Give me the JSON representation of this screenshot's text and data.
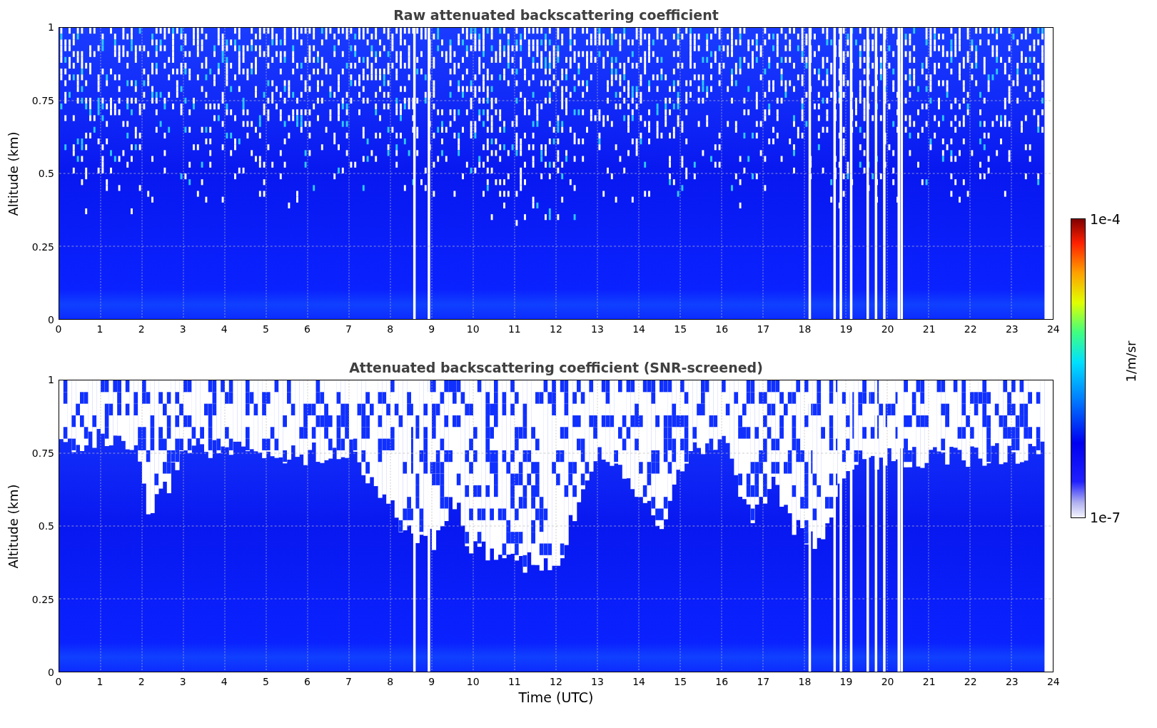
{
  "figure": {
    "panels": [
      {
        "kind": "raw",
        "title": "Raw attenuated backscattering coefficient",
        "ylabel": "Altitude (km)",
        "yticks": [
          "1",
          "0.75",
          "0.5",
          "0.25",
          "0"
        ],
        "xticks": [
          "0",
          "1",
          "2",
          "3",
          "4",
          "5",
          "6",
          "7",
          "8",
          "9",
          "10",
          "11",
          "12",
          "13",
          "14",
          "15",
          "16",
          "17",
          "18",
          "19",
          "20",
          "21",
          "22",
          "23",
          "24"
        ]
      },
      {
        "kind": "screened",
        "title": "Attenuated backscattering coefficient (SNR-screened)",
        "ylabel": "Altitude (km)",
        "yticks": [
          "1",
          "0.75",
          "0.5",
          "0.25",
          "0"
        ],
        "xticks": [
          "0",
          "1",
          "2",
          "3",
          "4",
          "5",
          "6",
          "7",
          "8",
          "9",
          "10",
          "11",
          "12",
          "13",
          "14",
          "15",
          "16",
          "17",
          "18",
          "19",
          "20",
          "21",
          "22",
          "23",
          "24"
        ]
      }
    ],
    "xlabel": "Time (UTC)",
    "colorbar": {
      "label": "1/m/sr",
      "max_label": "1e-4",
      "min_label": "1e-7"
    }
  }
}
